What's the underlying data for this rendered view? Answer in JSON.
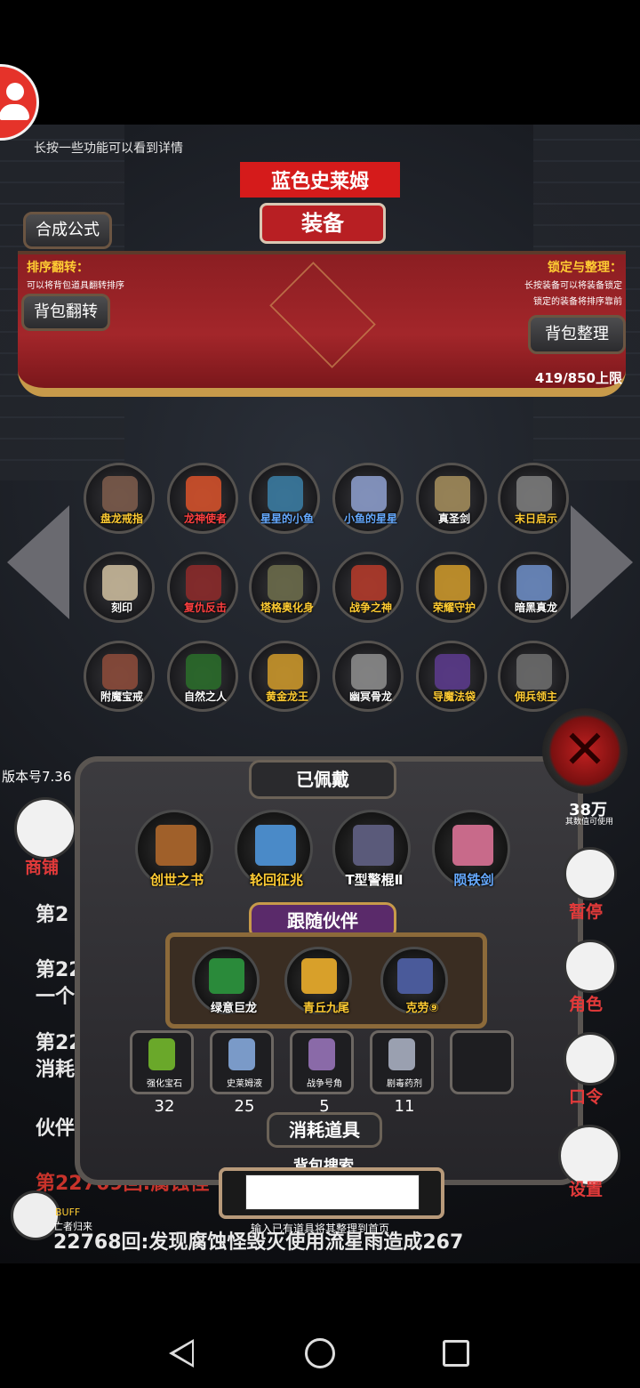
{
  "hint": "长按一些功能可以看到详情",
  "top_title": "蓝色史莱姆",
  "equip_title": "装备",
  "buttons": {
    "formula": "合成公式",
    "flip": "背包翻转",
    "organize": "背包整理"
  },
  "left_info": {
    "title": "排序翻转：",
    "desc": "可以将背包道具翻转排序"
  },
  "right_info": {
    "title": "锁定与整理：",
    "desc1": "长按装备可以将装备锁定",
    "desc2": "锁定的装备将排序靠前"
  },
  "capacity": "419/850上限",
  "grid_items": [
    {
      "name": "盘龙戒指",
      "color": "#ffcc33"
    },
    {
      "name": "龙神使者",
      "color": "#ff4040"
    },
    {
      "name": "星星的小鱼",
      "color": "#66aaff"
    },
    {
      "name": "小鱼的星星",
      "color": "#66aaff"
    },
    {
      "name": "真圣剑",
      "color": "#ffffff"
    },
    {
      "name": "末日启示",
      "color": "#ffcc33"
    },
    {
      "name": "刻印",
      "color": "#ffffff"
    },
    {
      "name": "复仇反击",
      "color": "#ff4040"
    },
    {
      "name": "塔格奥化身",
      "color": "#ffcc33"
    },
    {
      "name": "战争之神",
      "color": "#ffcc33"
    },
    {
      "name": "荣耀守护",
      "color": "#ffcc33"
    },
    {
      "name": "暗黑真龙",
      "color": "#ffffff"
    },
    {
      "name": "附魔宝戒",
      "color": "#ffffff"
    },
    {
      "name": "自然之人",
      "color": "#ffffff"
    },
    {
      "name": "黄金龙王",
      "color": "#ffcc33"
    },
    {
      "name": "幽冥骨龙",
      "color": "#ffffff"
    },
    {
      "name": "导魔法袋",
      "color": "#ffcc33"
    },
    {
      "name": "佣兵领主",
      "color": "#ffcc33"
    }
  ],
  "version": "版本号7.36",
  "worn_title": "已佩戴",
  "worn_items": [
    {
      "name": "创世之书",
      "color": "#ffcc33"
    },
    {
      "name": "轮回征兆",
      "color": "#ffcc33"
    },
    {
      "name": "T型警棍Ⅱ",
      "color": "#ffffff"
    },
    {
      "name": "陨铁剑",
      "color": "#66aaff"
    }
  ],
  "companion_title": "跟随伙伴",
  "companions": [
    {
      "name": "绿意巨龙",
      "color": "#ffffff"
    },
    {
      "name": "青丘九尾",
      "color": "#ffcc33"
    },
    {
      "name": "克劳⑨",
      "color": "#ffcc33"
    }
  ],
  "consumables": [
    {
      "name": "强化宝石",
      "count": "32"
    },
    {
      "name": "史莱姆液",
      "count": "25"
    },
    {
      "name": "战争号角",
      "count": "5"
    },
    {
      "name": "剧毒药剂",
      "count": "11"
    },
    {
      "name": "",
      "count": ""
    }
  ],
  "consumable_title": "消耗道具",
  "search_title": "背包搜索",
  "search_hint": "输入已有道具将其整理到首页",
  "shop_label": "商铺",
  "side_right": {
    "pause": "暂停",
    "role": "角色",
    "command": "口令",
    "settings": "设置"
  },
  "right_number": "38万",
  "right_small": "其数值可使用",
  "logs": [
    "第2",
    "第22",
    "一个",
    "第22",
    "消耗",
    "伙伴"
  ],
  "log_red": "第22769回:腐蚀怪",
  "log_bottom": "22768回:发现腐蚀怪毁灭使用流星雨造成267",
  "buff": "BUFF",
  "buff_desc": "亡者归来"
}
